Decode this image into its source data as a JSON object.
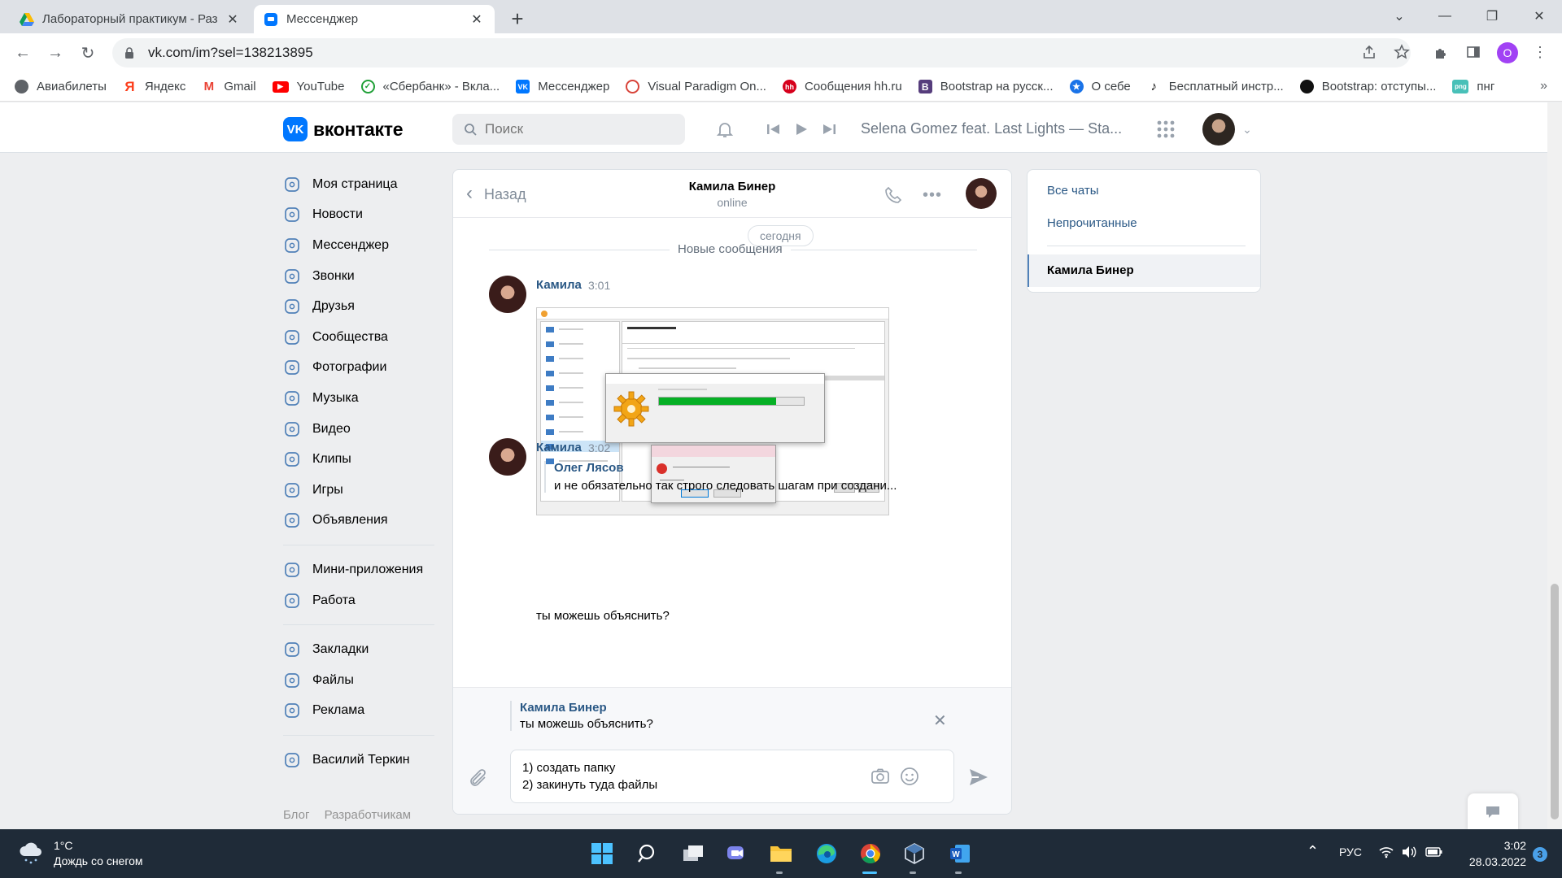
{
  "browser": {
    "tabs": [
      {
        "title": "Лабораторный практикум - Раз",
        "icon": "google-drive-icon"
      },
      {
        "title": "Мессенджер",
        "icon": "vk-messenger-icon",
        "active": true
      }
    ],
    "url": "vk.com/im?sel=138213895",
    "profile_initial": "О",
    "bookmarks": [
      {
        "label": "Авиабилеты",
        "icon": "globe-icon",
        "color": "#5f6368"
      },
      {
        "label": "Яндекс",
        "icon": "yandex-icon",
        "color": "#fc3f1d"
      },
      {
        "label": "Gmail",
        "icon": "gmail-icon",
        "color": "#ea4335"
      },
      {
        "label": "YouTube",
        "icon": "youtube-icon",
        "color": "#ff0000"
      },
      {
        "label": "«Сбербанк» - Вкла...",
        "icon": "sberbank-icon",
        "color": "#21a038"
      },
      {
        "label": "Мессенджер",
        "icon": "vk-icon",
        "color": "#0077ff"
      },
      {
        "label": "Visual Paradigm On...",
        "icon": "visual-paradigm-icon",
        "color": "#d8443a"
      },
      {
        "label": "Сообщения hh.ru",
        "icon": "hh-icon",
        "color": "#d6001c"
      },
      {
        "label": "Bootstrap на русск...",
        "icon": "bootstrap-icon",
        "color": "#563d7c"
      },
      {
        "label": "О себе",
        "icon": "star-icon",
        "color": "#1a73e8"
      },
      {
        "label": "Бесплатный инстр...",
        "icon": "tiktok-icon",
        "color": "#000000"
      },
      {
        "label": "Bootstrap: отступы...",
        "icon": "circle-icon",
        "color": "#111111"
      },
      {
        "label": "пнг",
        "icon": "png-icon",
        "color": "#48c0b8"
      }
    ]
  },
  "vk": {
    "logo_text": "вконтакте",
    "search_placeholder": "Поиск",
    "now_playing": "Selena Gomez feat. Last Lights — Sta...",
    "menu": [
      {
        "label": "Моя страница",
        "icon": "user-circle-icon"
      },
      {
        "label": "Новости",
        "icon": "news-icon"
      },
      {
        "label": "Мессенджер",
        "icon": "message-icon"
      },
      {
        "label": "Звонки",
        "icon": "phone-icon"
      },
      {
        "label": "Друзья",
        "icon": "friends-icon"
      },
      {
        "label": "Сообщества",
        "icon": "communities-icon"
      },
      {
        "label": "Фотографии",
        "icon": "photo-icon"
      },
      {
        "label": "Музыка",
        "icon": "music-icon"
      },
      {
        "label": "Видео",
        "icon": "video-icon"
      },
      {
        "label": "Клипы",
        "icon": "clips-icon"
      },
      {
        "label": "Игры",
        "icon": "gamepad-icon"
      },
      {
        "label": "Объявления",
        "icon": "ads-board-icon"
      }
    ],
    "menu2": [
      {
        "label": "Мини-приложения",
        "icon": "apps-icon"
      },
      {
        "label": "Работа",
        "icon": "briefcase-icon"
      }
    ],
    "menu3": [
      {
        "label": "Закладки",
        "icon": "star-icon"
      },
      {
        "label": "Файлы",
        "icon": "file-icon"
      },
      {
        "label": "Реклама",
        "icon": "megaphone-icon"
      }
    ],
    "menu4": [
      {
        "label": "Василий Теркин",
        "icon": "group-icon"
      }
    ],
    "footer": [
      "Блог",
      "Разработчикам"
    ]
  },
  "chat": {
    "back_label": "Назад",
    "name": "Камила Бинер",
    "status": "online",
    "date_pill": "сегодня",
    "new_messages_label": "Новые сообщения",
    "messages": [
      {
        "author": "Камила",
        "time": "3:01",
        "attachment": "screenshot"
      },
      {
        "author": "Камила",
        "time": "3:02",
        "quote_author": "Олег Лясов",
        "quote_text": "и не обязательно так строго следовать шагам при создани...",
        "text": "ты можешь объяснить?"
      }
    ],
    "reply": {
      "author": "Камила Бинер",
      "text": "ты можешь объяснить?"
    },
    "draft": "1) создать папку\n2) закинуть туда файлы"
  },
  "right_panel": {
    "all_chats": "Все чаты",
    "unread": "Непрочитанные",
    "active_chat": "Камила Бинер"
  },
  "taskbar": {
    "temperature": "1°C",
    "weather": "Дождь со снегом",
    "language": "РУС",
    "time": "3:02",
    "date": "28.03.2022",
    "notifications": "3"
  },
  "colors": {
    "vk_blue": "#0077ff",
    "link": "#2a5885",
    "taskbar": "#1f2b38"
  }
}
